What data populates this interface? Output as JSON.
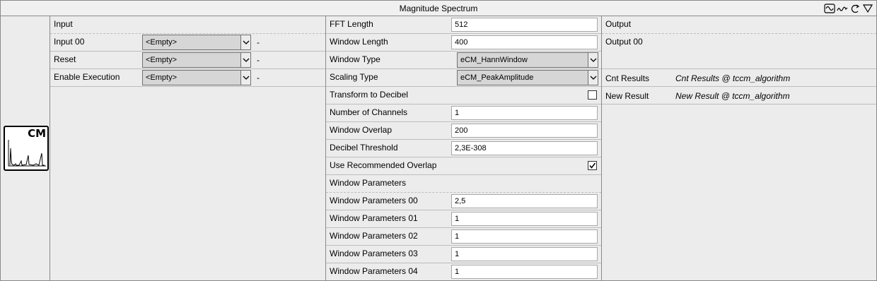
{
  "title": "Magnitude Spectrum",
  "title_icons": [
    "signal-wave-icon",
    "spectrum-icon",
    "rotate-icon",
    "triangle-down-icon"
  ],
  "block_icon": {
    "text": "CM",
    "icon": "magnitude-spectrum-icon"
  },
  "input": {
    "header": "Input",
    "rows": [
      {
        "label": "Input 00",
        "value": "<Empty>",
        "dash": "-"
      },
      {
        "label": "Reset",
        "value": "<Empty>",
        "dash": "-"
      },
      {
        "label": "Enable Execution",
        "value": "<Empty>",
        "dash": "-"
      }
    ]
  },
  "params": {
    "fft_length": {
      "label": "FFT Length",
      "value": "512"
    },
    "window_length": {
      "label": "Window Length",
      "value": "400"
    },
    "window_type": {
      "label": "Window Type",
      "value": "eCM_HannWindow"
    },
    "scaling_type": {
      "label": "Scaling Type",
      "value": "eCM_PeakAmplitude"
    },
    "transform_db": {
      "label": "Transform to Decibel",
      "checked": false
    },
    "num_channels": {
      "label": "Number of Channels",
      "value": "1"
    },
    "window_overlap": {
      "label": "Window Overlap",
      "value": "200"
    },
    "db_threshold": {
      "label": "Decibel Threshold",
      "value": "2,3E-308"
    },
    "use_rec_overlap": {
      "label": "Use Recommended Overlap",
      "checked": true
    },
    "window_params_header": "Window Parameters",
    "window_params": [
      {
        "label": "Window Parameters 00",
        "value": "2,5"
      },
      {
        "label": "Window Parameters 01",
        "value": "1"
      },
      {
        "label": "Window Parameters 02",
        "value": "1"
      },
      {
        "label": "Window Parameters 03",
        "value": "1"
      },
      {
        "label": "Window Parameters 04",
        "value": "1"
      }
    ]
  },
  "output": {
    "header": "Output",
    "output00": "Output 00",
    "results": [
      {
        "label": "Cnt Results",
        "value": "Cnt Results @ tccm_algorithm"
      },
      {
        "label": "New Result",
        "value": "New Result @ tccm_algorithm"
      }
    ]
  }
}
